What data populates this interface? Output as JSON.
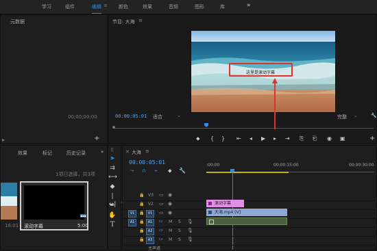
{
  "workspaces": [
    {
      "label": "学习",
      "active": false
    },
    {
      "label": "组件",
      "active": false
    },
    {
      "label": "编辑",
      "active": true
    },
    {
      "label": "颜色",
      "active": false
    },
    {
      "label": "效果",
      "active": false
    },
    {
      "label": "音频",
      "active": false
    },
    {
      "label": "图形",
      "active": false
    },
    {
      "label": "库",
      "active": false
    }
  ],
  "more_label": "»",
  "metadata_panel": {
    "title": "元数据",
    "timecode": "00;00;00;00"
  },
  "program": {
    "title": "节目: 大海",
    "caption_text": "这里是滚动字幕",
    "timecode": "00:00:05:01",
    "fit": "适合",
    "quality": "完整"
  },
  "project": {
    "tabs": [
      "效果",
      "标记",
      "历史记录"
    ],
    "selection_info": "1项已选择，共3项",
    "clip_left_duration": "16:01",
    "clip_name": "滚动字幕",
    "clip_duration": "5:00"
  },
  "timeline": {
    "title": "大海",
    "timecode": "00:00:05:01",
    "ruler": [
      ":00:00",
      "00:00:15:00",
      "00:00:30:00"
    ],
    "tracks": [
      {
        "name": "V3",
        "type": "video",
        "source": ""
      },
      {
        "name": "V2",
        "type": "video",
        "source": ""
      },
      {
        "name": "V1",
        "type": "video",
        "source": "V1"
      },
      {
        "name": "A1",
        "type": "audio",
        "source": "A1"
      },
      {
        "name": "A2",
        "type": "audio",
        "source": ""
      },
      {
        "name": "A3",
        "type": "audio",
        "source": ""
      }
    ],
    "mix_label": "主声道",
    "clips": {
      "subtitle": "滚动字幕",
      "video": "大海.mp4 [V]"
    }
  },
  "colors": {
    "accent": "#2d8ceb",
    "subtitle_clip": "#e38ee6",
    "video_clip": "#8fa8d6",
    "arrow": "#e0322b"
  }
}
